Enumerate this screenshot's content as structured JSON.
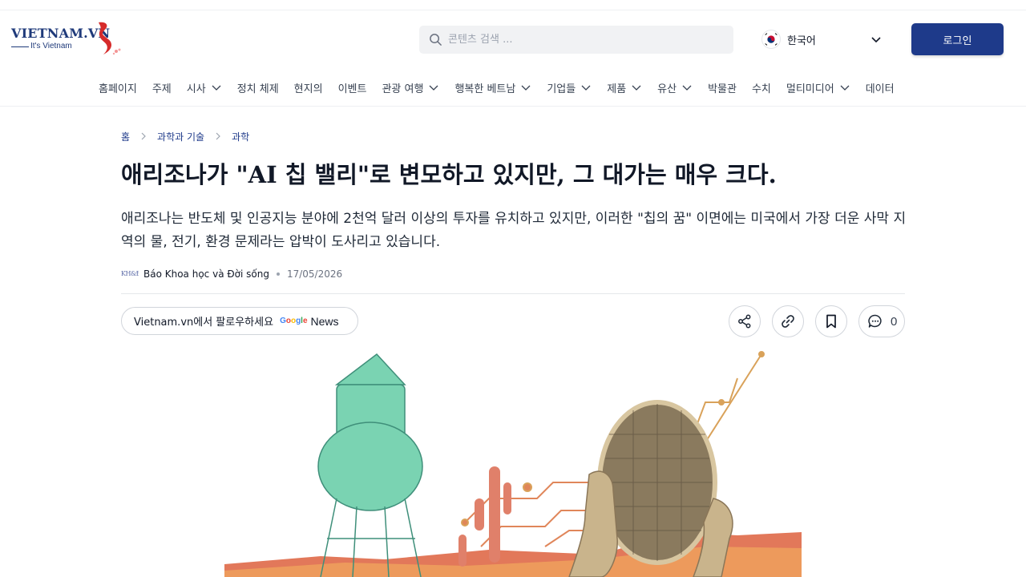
{
  "header": {
    "logo_text": "VIETNAM.VN",
    "logo_tagline": "It's Vietnam",
    "search_placeholder": "콘텐츠 검색 ...",
    "language": "한국어",
    "login_label": "로그인"
  },
  "nav": {
    "items": [
      {
        "label": "홈페이지",
        "has_dropdown": false
      },
      {
        "label": "주제",
        "has_dropdown": false
      },
      {
        "label": "시사",
        "has_dropdown": true
      },
      {
        "label": "정치 체제",
        "has_dropdown": false
      },
      {
        "label": "현지의",
        "has_dropdown": false
      },
      {
        "label": "이벤트",
        "has_dropdown": false
      },
      {
        "label": "관광 여행",
        "has_dropdown": true
      },
      {
        "label": "행복한 베트남",
        "has_dropdown": true
      },
      {
        "label": "기업들",
        "has_dropdown": true
      },
      {
        "label": "제품",
        "has_dropdown": true
      },
      {
        "label": "유산",
        "has_dropdown": true
      },
      {
        "label": "박물관",
        "has_dropdown": false
      },
      {
        "label": "수치",
        "has_dropdown": false
      },
      {
        "label": "멀티미디어",
        "has_dropdown": true
      },
      {
        "label": "데이터",
        "has_dropdown": false
      }
    ]
  },
  "breadcrumb": [
    "홈",
    "과학과 기술",
    "과학"
  ],
  "article": {
    "title": "애리조나가 \"AI 칩 밸리\"로 변모하고 있지만, 그 대가는 매우 크다.",
    "summary": "애리조나는 반도체 및 인공지능 분야에 2천억 달러 이상의 투자를 유치하고 있지만, 이러한 \"칩의 꿈\" 이면에는 미국에서 가장 더운 사막 지역의 물, 전기, 환경 문제라는 압박이 도사리고 있습니다.",
    "publisher": "Báo Khoa học và Đời sống",
    "date": "17/05/2026"
  },
  "actions": {
    "follow_label": "Vietnam.vn에서 팔로우하세요",
    "google_word": "Google",
    "news_word": "News",
    "comment_count": "0"
  },
  "colors": {
    "brand": "#1e3a8a",
    "accent_red": "#d62b2b",
    "tower_green": "#6fcfae"
  }
}
